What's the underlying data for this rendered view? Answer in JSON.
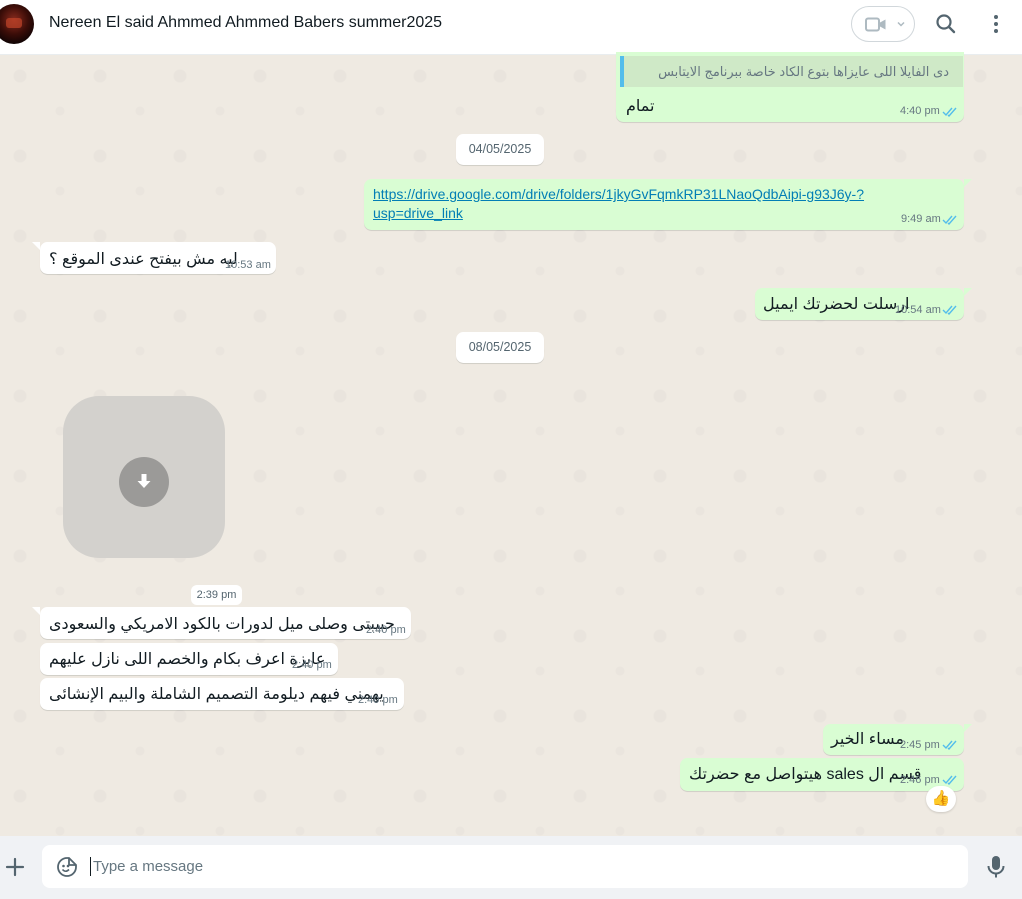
{
  "header": {
    "contact_name": "Nereen El said Ahmmed Ahmmed Babers summer2025"
  },
  "messages": {
    "quoted_text": "دى الفايلا اللى عايزاها بتوع الكاد خاصة ببرنامج الايتابس",
    "m1_text": "تمام",
    "m1_time": "4:40 pm",
    "date1": "04/05/2025",
    "m2_link_line1": "https://drive.google.com/drive/folders/1jkyGvFqmkRP31LNaoQdbAipi-g93J6y-?",
    "m2_link_line2": "usp=drive_link",
    "m2_time": "9:49 am",
    "m3_text": "ليه مش بيفتح عندى الموقع ؟",
    "m3_time": "10:53 am",
    "m4_text": "ارسلت لحضرتك ايميل",
    "m4_time": "10:54 am",
    "date2": "08/05/2025",
    "media_time": "2:39 pm",
    "m5_text": "حبيبتى وصلى ميل لدورات بالكود الامريكي والسعودى",
    "m5_time": "2:40 pm",
    "m6_text": "عايزة اعرف بكام والخصم اللى نازل عليهم",
    "m6_time": "2:40 pm",
    "m7_text": "يهمني فيهم ديلومة التصميم الشاملة والبيم الإنشائى",
    "m7_time": "2:40 pm",
    "m8_text": "مساء الخير",
    "m8_time": "2:45 pm",
    "m9_text": "قسم ال sales هيتواصل مع حضرتك",
    "m9_time": "2:46 pm",
    "reaction": "👍"
  },
  "composer": {
    "placeholder": "Type a message"
  },
  "colors": {
    "outgoing_bubble": "#d9fdd3",
    "incoming_bubble": "#ffffff",
    "chat_background": "#efeae2",
    "read_ticks": "#53bdeb"
  },
  "icons": [
    "video-call-icon",
    "search-icon",
    "menu-icon",
    "download-icon",
    "plus-icon",
    "emoji-icon",
    "mic-icon",
    "double-check-icon"
  ]
}
